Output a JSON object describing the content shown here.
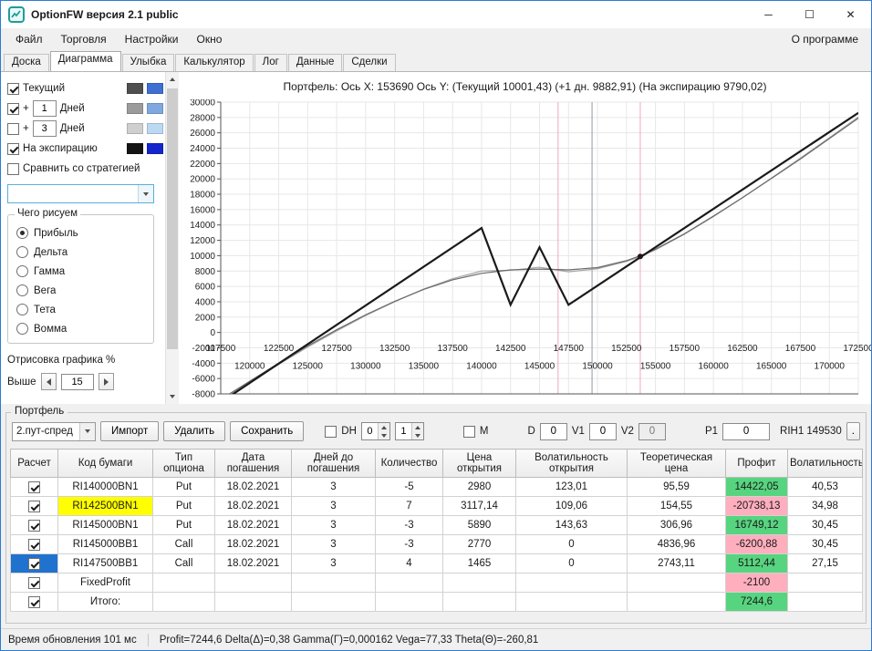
{
  "colors": {
    "profit_positive": "#57d47f",
    "profit_negative": "#ffaebe",
    "code_highlight": "#ffff00",
    "selected_cell": "#2072cf",
    "accent_border": "#2b7cd3"
  },
  "window": {
    "title": "OptionFW версия 2.1 public",
    "minimize_glyph": "─",
    "maximize_glyph": "☐",
    "close_glyph": "✕"
  },
  "menu": {
    "items": [
      "Файл",
      "Торговля",
      "Настройки",
      "Окно"
    ],
    "right_item": "О программе"
  },
  "tabs": {
    "items": [
      "Доска",
      "Диаграмма",
      "Улыбка",
      "Калькулятор",
      "Лог",
      "Данные",
      "Сделки"
    ],
    "active_index": 1
  },
  "plot_options": {
    "rows": [
      {
        "label": "Текущий",
        "checked": true,
        "swatches": [
          "#4f4f4f",
          "#3e6fd1"
        ]
      },
      {
        "label": "+",
        "checked": true,
        "value": "1",
        "suffix": "Дней",
        "swatches": [
          "#9b9b9b",
          "#7fa8e0"
        ]
      },
      {
        "label": "+",
        "checked": false,
        "value": "3",
        "suffix": "Дней",
        "swatches": [
          "#cfcfcf",
          "#bcd8f2"
        ]
      },
      {
        "label": "На экспирацию",
        "checked": true,
        "swatches": [
          "#141414",
          "#1326cc"
        ]
      },
      {
        "label": "Сравнить со стратегией",
        "checked": false
      }
    ],
    "strategy_combo_value": "",
    "draw_group": {
      "title": "Чего рисуем",
      "selected_index": 0,
      "options": [
        "Прибыль",
        "Дельта",
        "Гамма",
        "Вега",
        "Тета",
        "Вомма"
      ]
    },
    "render_group": {
      "title": "Отрисовка графика %",
      "above_label": "Выше",
      "above_value": "15"
    }
  },
  "chart_data": {
    "type": "line",
    "title": "Портфель: Ось X: 153690 Ось Y:  (Текущий 10001,43)  (+1 дн. 9882,91)  (На экспирацию 9790,02)",
    "xlim": [
      117500,
      172500
    ],
    "ylim": [
      -8000,
      30000
    ],
    "x_tick_step": 2500,
    "y_tick_step": 2000,
    "x_ticks_row1": [
      117500,
      122500,
      127500,
      132500,
      137500,
      142500,
      147500,
      152500,
      157500,
      162500,
      167500,
      172500
    ],
    "x_ticks_row2": [
      120000,
      125000,
      130000,
      135000,
      140000,
      145000,
      150000,
      155000,
      160000,
      165000,
      170000
    ],
    "grid": true,
    "vlines": [
      {
        "x": 146600,
        "color": "#efa9bc"
      },
      {
        "x": 149530,
        "color": "#9099a8"
      },
      {
        "x": 153690,
        "color": "#efa9bc"
      }
    ],
    "marker": {
      "x": 153690,
      "y": 9900,
      "color": "#1a1a1a"
    },
    "series": [
      {
        "name": "На экспирацию",
        "color": "#1a1a1a",
        "width": 2.2,
        "points": [
          [
            117500,
            -9100
          ],
          [
            140000,
            13600
          ],
          [
            142500,
            3600
          ],
          [
            145000,
            11100
          ],
          [
            147500,
            3600
          ],
          [
            172500,
            28600
          ]
        ]
      },
      {
        "name": "Текущий",
        "color": "#6a6a6a",
        "width": 1.2,
        "points": [
          [
            117500,
            -8700
          ],
          [
            120000,
            -6350
          ],
          [
            122500,
            -4000
          ],
          [
            125000,
            -1750
          ],
          [
            127500,
            350
          ],
          [
            130000,
            2300
          ],
          [
            132500,
            4050
          ],
          [
            135000,
            5600
          ],
          [
            137500,
            6850
          ],
          [
            140000,
            7700
          ],
          [
            142500,
            8150
          ],
          [
            145000,
            8250
          ],
          [
            147500,
            8150
          ],
          [
            150000,
            8450
          ],
          [
            152500,
            9350
          ],
          [
            153690,
            10001
          ],
          [
            155000,
            10850
          ],
          [
            157500,
            12850
          ],
          [
            160000,
            15150
          ],
          [
            162500,
            17550
          ],
          [
            165000,
            20050
          ],
          [
            167500,
            22600
          ],
          [
            170000,
            25250
          ],
          [
            172500,
            27900
          ]
        ]
      },
      {
        "name": "+1 день",
        "color": "#a5a5a5",
        "width": 1.2,
        "points": [
          [
            117500,
            -8850
          ],
          [
            120000,
            -6500
          ],
          [
            122500,
            -4150
          ],
          [
            125000,
            -1900
          ],
          [
            127500,
            200
          ],
          [
            130000,
            2200
          ],
          [
            132500,
            4000
          ],
          [
            135000,
            5650
          ],
          [
            137500,
            7000
          ],
          [
            140000,
            8000
          ],
          [
            142500,
            8100
          ],
          [
            145000,
            8500
          ],
          [
            147500,
            7900
          ],
          [
            150000,
            8300
          ],
          [
            152500,
            9250
          ],
          [
            153690,
            9883
          ],
          [
            155000,
            10750
          ],
          [
            157500,
            12800
          ],
          [
            160000,
            15100
          ],
          [
            162500,
            17550
          ],
          [
            165000,
            20100
          ],
          [
            167500,
            22700
          ],
          [
            170000,
            25350
          ],
          [
            172500,
            28050
          ]
        ]
      }
    ]
  },
  "portfolio": {
    "group_title": "Портфель",
    "toolbar": {
      "combo_value": "2.пут-спред",
      "import_label": "Импорт",
      "delete_label": "Удалить",
      "save_label": "Сохранить",
      "dh_label": "DH",
      "dh_spin1": "0",
      "dh_spin2": "1",
      "m_label": "M",
      "d_label": "D",
      "d_value": "0",
      "v1_label": "V1",
      "v1_value": "0",
      "v2_label": "V2",
      "v2_value": "0",
      "p1_label": "P1",
      "p1_value": "0",
      "instrument": "RIH1 149530",
      "more_label": "."
    },
    "table": {
      "columns": [
        "Расчет",
        "Код бумаги",
        "Тип опциона",
        "Дата погашения",
        "Дней до погашения",
        "Количество",
        "Цена открытия",
        "Волатильность открытия",
        "Теоретическая цена",
        "Профит",
        "Волатильность"
      ],
      "rows": [
        {
          "checked": true,
          "cells": [
            "RI140000BN1",
            "Put",
            "18.02.2021",
            "3",
            "-5",
            "2980",
            "123,01",
            "95,59",
            "14422,05",
            "40,53"
          ],
          "profit_positive": true
        },
        {
          "checked": true,
          "code_highlighted": true,
          "cells": [
            "RI142500BN1",
            "Put",
            "18.02.2021",
            "3",
            "7",
            "3117,14",
            "109,06",
            "154,55",
            "-20738,13",
            "34,98"
          ],
          "profit_positive": false
        },
        {
          "checked": true,
          "cells": [
            "RI145000BN1",
            "Put",
            "18.02.2021",
            "3",
            "-3",
            "5890",
            "143,63",
            "306,96",
            "16749,12",
            "30,45"
          ],
          "profit_positive": true
        },
        {
          "checked": true,
          "cells": [
            "RI145000BB1",
            "Call",
            "18.02.2021",
            "3",
            "-3",
            "2770",
            "0",
            "4836,96",
            "-6200,88",
            "30,45"
          ],
          "profit_positive": false
        },
        {
          "checked": true,
          "selected": true,
          "cells": [
            "RI147500BB1",
            "Call",
            "18.02.2021",
            "3",
            "4",
            "1465",
            "0",
            "2743,11",
            "5112,44",
            "27,15"
          ],
          "profit_positive": true
        },
        {
          "checked": true,
          "cells": [
            "FixedProfit",
            "",
            "",
            "",
            "",
            "",
            "",
            "",
            "-2100",
            ""
          ],
          "profit_positive": false
        },
        {
          "checked": true,
          "cells": [
            "Итого:",
            "",
            "",
            "",
            "",
            "",
            "",
            "",
            "7244,6",
            ""
          ],
          "profit_positive": true
        }
      ]
    }
  },
  "statusbar": {
    "update_time": "Время обновления 101 мс",
    "greeks": "Profit=7244,6 Delta(Δ)=0,38 Gamma(Γ)=0,000162 Vega=77,33 Theta(Θ)=-260,81"
  }
}
